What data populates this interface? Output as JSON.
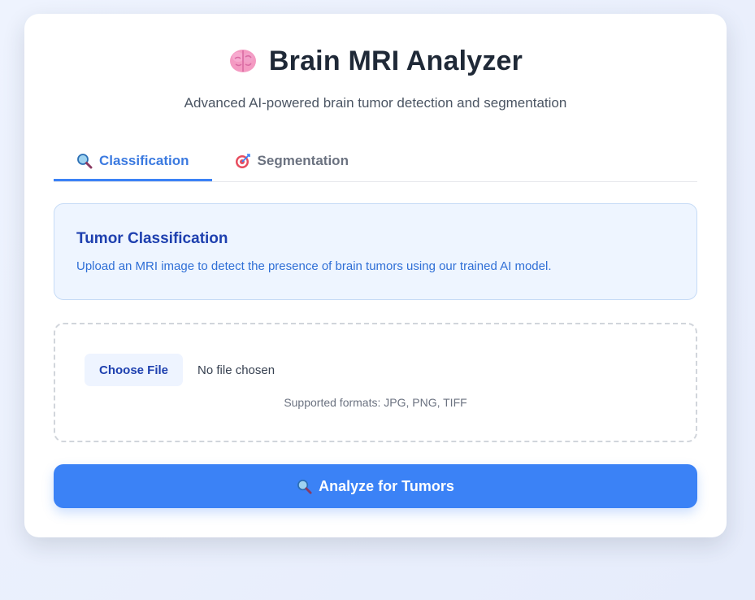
{
  "header": {
    "title": "Brain MRI Analyzer",
    "subtitle": "Advanced AI-powered brain tumor detection and segmentation",
    "icon": "brain-icon"
  },
  "tabs": [
    {
      "label": "Classification",
      "icon": "magnifier-icon",
      "active": true
    },
    {
      "label": "Segmentation",
      "icon": "target-icon",
      "active": false
    }
  ],
  "info": {
    "title": "Tumor Classification",
    "description": "Upload an MRI image to detect the presence of brain tumors using our trained AI model."
  },
  "upload": {
    "choose_label": "Choose File",
    "status": "No file chosen",
    "formats": "Supported formats: JPG, PNG, TIFF"
  },
  "action": {
    "label": "Analyze for Tumors",
    "icon": "magnifier-icon"
  },
  "colors": {
    "accent": "#3b82f6",
    "info_bg": "#eef5ff",
    "title_text": "#1f2937"
  }
}
